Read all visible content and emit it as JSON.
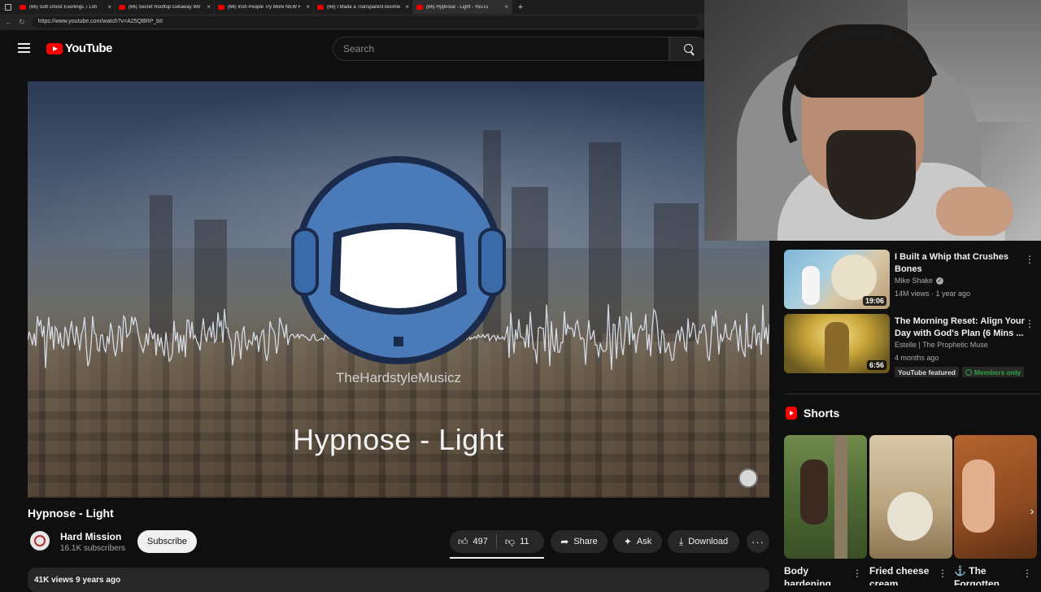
{
  "browser": {
    "tabs": [
      {
        "title": "(66) Soft Ghost Evenings ♪ Lofi"
      },
      {
        "title": "(66) Secret Rooftop Getaway Wit"
      },
      {
        "title": "(66) Irish People Try More NEW F"
      },
      {
        "title": "(66) I Made a Transparent Boome"
      },
      {
        "title": "(66) Hypnose - Light - YouTu"
      }
    ],
    "url": "https://www.youtube.com/watch?v=A25QBRP_bII"
  },
  "masthead": {
    "logo_text": "YouTube",
    "search_placeholder": "Search"
  },
  "player": {
    "watermark_channel": "TheHardstyleMusicz",
    "overlay_title": "Hypnose - Light"
  },
  "video": {
    "title": "Hypnose - Light",
    "channel": "Hard Mission",
    "subscribers": "16.1K subscribers",
    "subscribe_label": "Subscribe",
    "likes": "497",
    "dislikes": "11",
    "share_label": "Share",
    "ask_label": "Ask",
    "download_label": "Download",
    "more_label": "···",
    "views_line": "41K views  9 years ago"
  },
  "recommendations": [
    {
      "title": "I Built a Whip that Crushes Bones",
      "channel": "Mike Shake",
      "meta": "14M views · 1 year ago",
      "duration": "19:06"
    },
    {
      "title": "The Morning Reset: Align Your Day with God's Plan (6 Mins ...",
      "channel": "Estelle | The Prophetic Muse",
      "meta": "4 months ago",
      "duration": "6:56",
      "badge_featured": "YouTube featured",
      "badge_members": "Members only"
    }
  ],
  "shorts": {
    "heading": "Shorts",
    "items": [
      {
        "title": "Body hardening"
      },
      {
        "title": "Fried cheese cream"
      },
      {
        "title": "⚓ The Forgotten"
      }
    ]
  },
  "icons": {
    "verified": "✓",
    "next": "›",
    "kebab": "⋮"
  }
}
